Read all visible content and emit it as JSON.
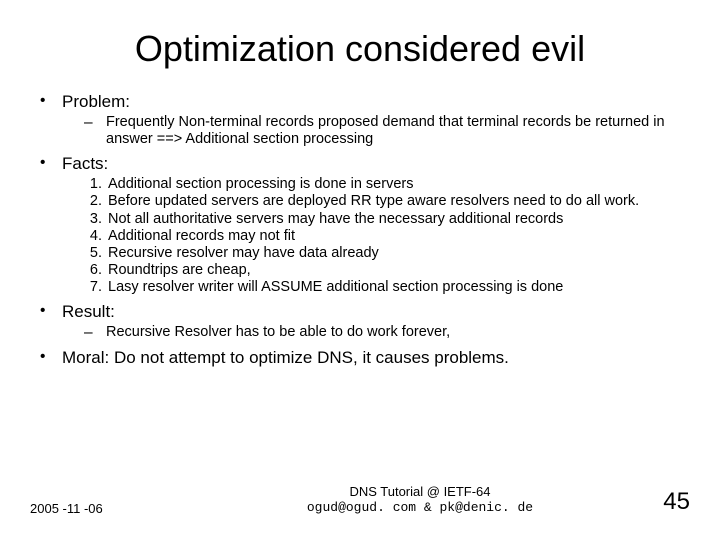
{
  "title": "Optimization considered evil",
  "sections": {
    "problem": {
      "label": "Problem:",
      "items": [
        "Frequently Non-terminal records proposed demand that terminal records be returned in answer ==> Additional section processing"
      ]
    },
    "facts": {
      "label": "Facts:",
      "items": [
        "Additional section processing is done in servers",
        "Before updated servers are deployed RR type aware resolvers need to do all work.",
        "Not all authoritative servers may have the necessary additional records",
        "Additional records may not fit",
        "Recursive resolver may have data already",
        "Roundtrips are cheap,",
        "Lasy resolver writer will ASSUME additional section processing is done"
      ]
    },
    "result": {
      "label": "Result:",
      "items": [
        "Recursive Resolver has to be able to do work forever,"
      ]
    },
    "moral": {
      "label": "Moral: Do not attempt to optimize DNS, it causes problems."
    }
  },
  "footer": {
    "date": "2005 -11 -06",
    "center_line1": "DNS Tutorial @ IETF-64",
    "center_line2": "ogud@ogud. com & pk@denic. de",
    "page": "45"
  }
}
